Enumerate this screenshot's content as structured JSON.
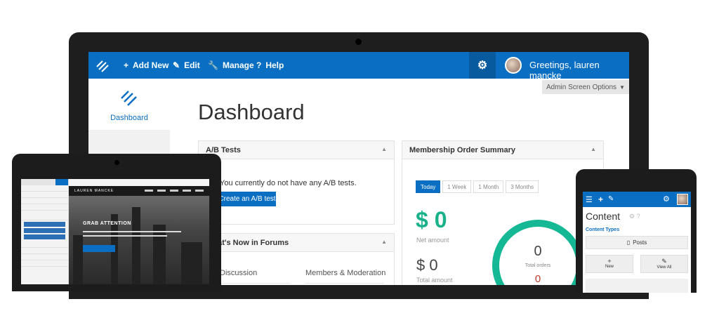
{
  "laptop": {
    "topbar": {
      "menu": [
        {
          "icon": "+",
          "label": "Add New"
        },
        {
          "icon": "✎",
          "label": "Edit"
        },
        {
          "icon": "🔧",
          "label": "Manage"
        },
        {
          "icon": "?",
          "label": "Help"
        }
      ],
      "greeting": "Greetings, lauren mancke"
    },
    "sidebar": {
      "dashboard_label": "Dashboard"
    },
    "screen_options": "Admin Screen Options",
    "page_title": "Dashboard",
    "ab_panel": {
      "title": "A/B Tests",
      "message": "You currently do not have any A/B tests.",
      "button": "Create an A/B test"
    },
    "forums_panel": {
      "title": "What's Now in Forums",
      "col1": "Discussion",
      "col2": "Members & Moderation"
    },
    "membership_panel": {
      "title": "Membership Order Summary",
      "tabs": [
        "Today",
        "1 Week",
        "1 Month",
        "3 Months"
      ],
      "net_amount": "$ 0",
      "net_label": "Net amount",
      "total_amount": "$ 0",
      "total_label": "Total amount",
      "total_orders": "0",
      "total_orders_label": "Total orders",
      "second_value": "0"
    },
    "colors": {
      "brand": "#0a6fc2",
      "accent_green": "#19b18a"
    }
  },
  "tablet": {
    "nav_brand": "LAUREN MANCKE",
    "hero_heading": "GRAB ATTENTION"
  },
  "phone": {
    "title": "Content",
    "content_types": "Content Types",
    "posts": "Posts",
    "new_label": "New",
    "view_all_label": "View All"
  }
}
